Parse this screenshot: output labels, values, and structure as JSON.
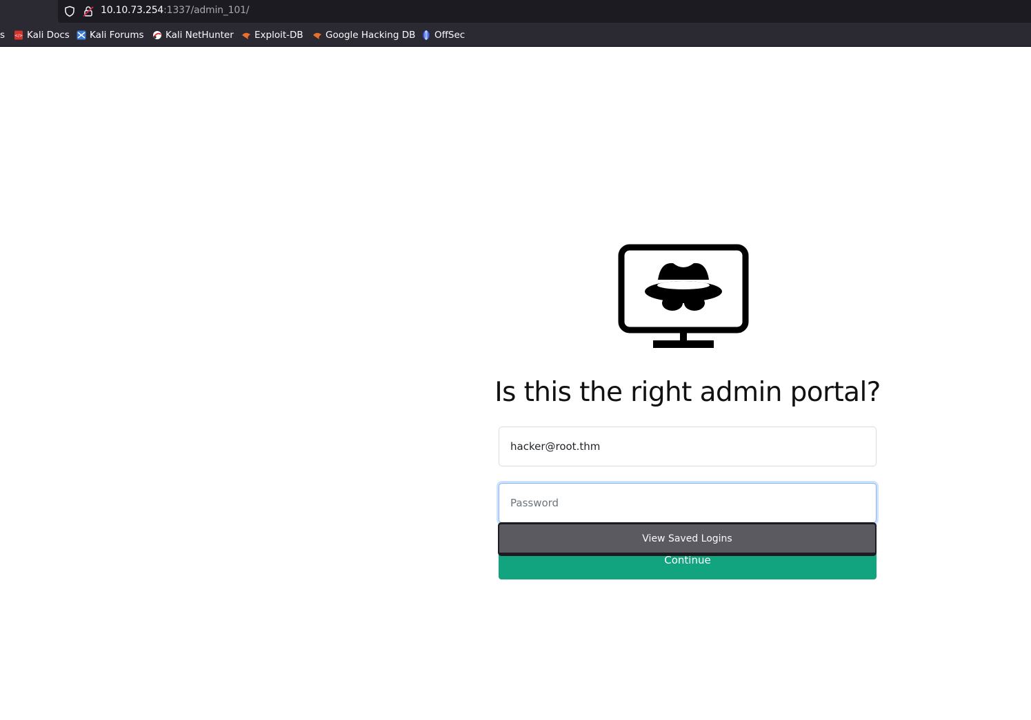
{
  "browser": {
    "url_host": "10.10.73.254",
    "url_rest": ":1337/admin_101/",
    "bookmarks": [
      {
        "label": "s",
        "icon": "truncated"
      },
      {
        "label": "Kali Docs",
        "icon": "kali-docs-icon"
      },
      {
        "label": "Kali Forums",
        "icon": "kali-forums-icon"
      },
      {
        "label": "Kali NetHunter",
        "icon": "kali-nethunter-icon"
      },
      {
        "label": "Exploit-DB",
        "icon": "exploit-db-icon"
      },
      {
        "label": "Google Hacking DB",
        "icon": "ghdb-icon"
      },
      {
        "label": "OffSec",
        "icon": "offsec-icon"
      }
    ]
  },
  "page": {
    "logo_icon": "monitor-spy-icon",
    "heading": "Is this the right admin portal?",
    "email_value": "hacker@root.thm",
    "password_placeholder": "Password",
    "continue_label": "Continue",
    "saved_logins_label": "View Saved Logins",
    "colors": {
      "continue_bg": "#12a37f",
      "focus_ring": "#86b7fe",
      "autocomplete_bg": "#5a5a60"
    }
  }
}
